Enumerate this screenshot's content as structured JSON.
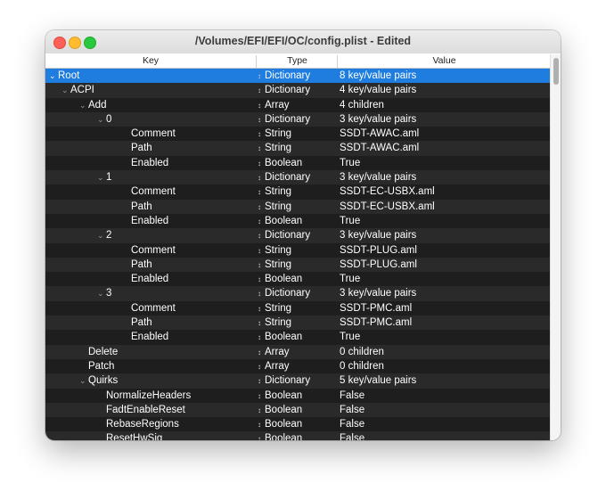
{
  "window": {
    "title": "/Volumes/EFI/EFI/OC/config.plist - Edited"
  },
  "columns": {
    "key": "Key",
    "type": "Type",
    "value": "Value"
  },
  "rows": [
    {
      "key": "Root",
      "type": "Dictionary",
      "value": "8 key/value pairs",
      "level": 0,
      "expand": true,
      "selected": true
    },
    {
      "key": "ACPI",
      "type": "Dictionary",
      "value": "4 key/value pairs",
      "level": 1,
      "expand": true
    },
    {
      "key": "Add",
      "type": "Array",
      "value": "4 children",
      "level": 2,
      "expand": true
    },
    {
      "key": "0",
      "type": "Dictionary",
      "value": "3 key/value pairs",
      "level": 3,
      "expand": true
    },
    {
      "key": "Comment",
      "type": "String",
      "value": "SSDT-AWAC.aml",
      "level": 4
    },
    {
      "key": "Path",
      "type": "String",
      "value": "SSDT-AWAC.aml",
      "level": 4
    },
    {
      "key": "Enabled",
      "type": "Boolean",
      "value": "True",
      "level": 4
    },
    {
      "key": "1",
      "type": "Dictionary",
      "value": "3 key/value pairs",
      "level": 3,
      "expand": true
    },
    {
      "key": "Comment",
      "type": "String",
      "value": "SSDT-EC-USBX.aml",
      "level": 4
    },
    {
      "key": "Path",
      "type": "String",
      "value": "SSDT-EC-USBX.aml",
      "level": 4
    },
    {
      "key": "Enabled",
      "type": "Boolean",
      "value": "True",
      "level": 4
    },
    {
      "key": "2",
      "type": "Dictionary",
      "value": "3 key/value pairs",
      "level": 3,
      "expand": true
    },
    {
      "key": "Comment",
      "type": "String",
      "value": "SSDT-PLUG.aml",
      "level": 4
    },
    {
      "key": "Path",
      "type": "String",
      "value": "SSDT-PLUG.aml",
      "level": 4
    },
    {
      "key": "Enabled",
      "type": "Boolean",
      "value": "True",
      "level": 4
    },
    {
      "key": "3",
      "type": "Dictionary",
      "value": "3 key/value pairs",
      "level": 3,
      "expand": true
    },
    {
      "key": "Comment",
      "type": "String",
      "value": "SSDT-PMC.aml",
      "level": 4
    },
    {
      "key": "Path",
      "type": "String",
      "value": "SSDT-PMC.aml",
      "level": 4
    },
    {
      "key": "Enabled",
      "type": "Boolean",
      "value": "True",
      "level": 4
    },
    {
      "key": "Delete",
      "type": "Array",
      "value": "0 children",
      "level": 2
    },
    {
      "key": "Patch",
      "type": "Array",
      "value": "0 children",
      "level": 2
    },
    {
      "key": "Quirks",
      "type": "Dictionary",
      "value": "5 key/value pairs",
      "level": 2,
      "expand": true
    },
    {
      "key": "NormalizeHeaders",
      "type": "Boolean",
      "value": "False",
      "level": 3
    },
    {
      "key": "FadtEnableReset",
      "type": "Boolean",
      "value": "False",
      "level": 3
    },
    {
      "key": "RebaseRegions",
      "type": "Boolean",
      "value": "False",
      "level": 3
    },
    {
      "key": "ResetHwSig",
      "type": "Boolean",
      "value": "False",
      "level": 3
    }
  ],
  "colors": {
    "selection": "#1f7de0",
    "row_dark": "#1e1e1e",
    "row_alt": "#2a2a2a"
  }
}
